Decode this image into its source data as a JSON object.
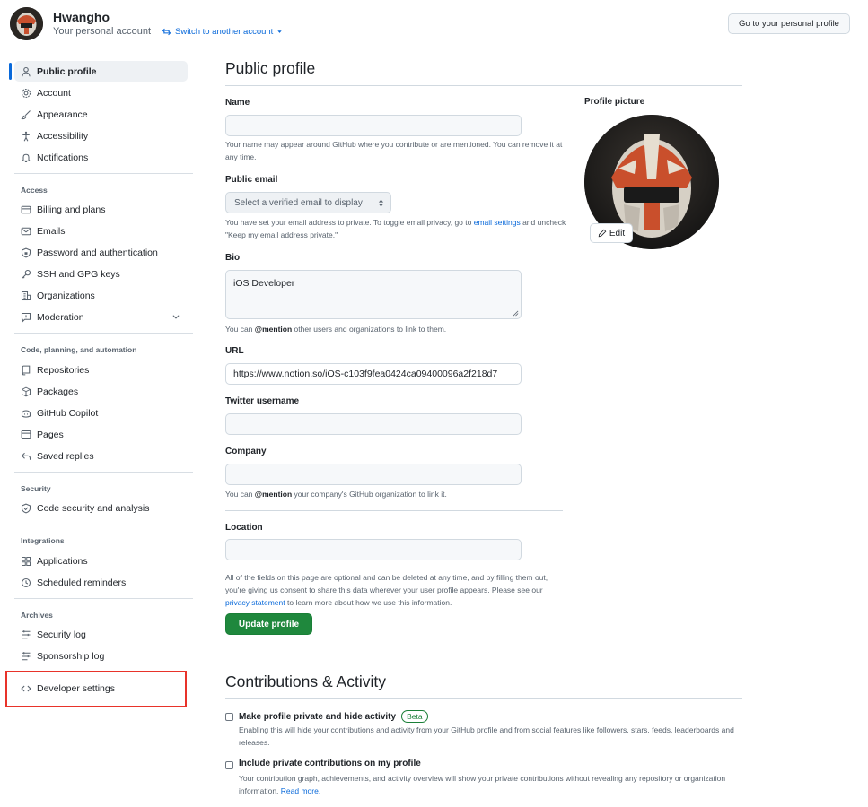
{
  "header": {
    "username": "Hwangho",
    "subtitle": "Your personal account",
    "switch_label": "Switch to another account",
    "go_profile_label": "Go to your personal profile"
  },
  "sidebar": {
    "top_items": [
      {
        "label": "Public profile",
        "icon": "person-icon",
        "active": true
      },
      {
        "label": "Account",
        "icon": "gear-icon"
      },
      {
        "label": "Appearance",
        "icon": "paintbrush-icon"
      },
      {
        "label": "Accessibility",
        "icon": "accessibility-icon"
      },
      {
        "label": "Notifications",
        "icon": "bell-icon"
      }
    ],
    "access_heading": "Access",
    "access_items": [
      {
        "label": "Billing and plans",
        "icon": "credit-card-icon"
      },
      {
        "label": "Emails",
        "icon": "mail-icon"
      },
      {
        "label": "Password and authentication",
        "icon": "shield-lock-icon"
      },
      {
        "label": "SSH and GPG keys",
        "icon": "key-icon"
      },
      {
        "label": "Organizations",
        "icon": "organization-icon"
      },
      {
        "label": "Moderation",
        "icon": "report-icon"
      }
    ],
    "code_heading": "Code, planning, and automation",
    "code_items": [
      {
        "label": "Repositories",
        "icon": "repo-icon"
      },
      {
        "label": "Packages",
        "icon": "package-icon"
      },
      {
        "label": "GitHub Copilot",
        "icon": "copilot-icon"
      },
      {
        "label": "Pages",
        "icon": "browser-icon"
      },
      {
        "label": "Saved replies",
        "icon": "reply-icon"
      }
    ],
    "security_heading": "Security",
    "security_items": [
      {
        "label": "Code security and analysis",
        "icon": "shield-icon"
      }
    ],
    "integrations_heading": "Integrations",
    "integrations_items": [
      {
        "label": "Applications",
        "icon": "apps-icon"
      },
      {
        "label": "Scheduled reminders",
        "icon": "clock-icon"
      }
    ],
    "archives_heading": "Archives",
    "archives_items": [
      {
        "label": "Security log",
        "icon": "log-icon"
      },
      {
        "label": "Sponsorship log",
        "icon": "log-icon"
      }
    ],
    "developer_settings": {
      "label": "Developer settings",
      "icon": "code-icon"
    }
  },
  "main": {
    "title": "Public profile",
    "name_label": "Name",
    "name_value": "",
    "name_hint": "Your name may appear around GitHub where you contribute or are mentioned. You can remove it at any time.",
    "email_label": "Public email",
    "email_select": "Select a verified email to display",
    "email_hint_1": "You have set your email address to private. To toggle email privacy, go to",
    "email_hint_link": "email settings",
    "email_hint_2": "and uncheck \"Keep my email address private.\"",
    "bio_label": "Bio",
    "bio_value": "iOS Developer",
    "bio_hint_1": "You can",
    "bio_hint_bold": "@mention",
    "bio_hint_2": "other users and organizations to link to them.",
    "url_label": "URL",
    "url_value": "https://www.notion.so/iOS-c103f9fea0424ca09400096a2f218d7",
    "twitter_label": "Twitter username",
    "twitter_value": "",
    "company_label": "Company",
    "company_value": "",
    "company_hint_1": "You can",
    "company_hint_bold": "@mention",
    "company_hint_2": "your company's GitHub organization to link it.",
    "location_label": "Location",
    "location_value": "",
    "consent_1": "All of the fields on this page are optional and can be deleted at any time, and by filling them out, you're giving us consent to share this data wherever your user profile appears. Please see our",
    "consent_link": "privacy statement",
    "consent_2": "to learn more about how we use this information.",
    "update_label": "Update profile",
    "picture_label": "Profile picture",
    "edit_label": "Edit",
    "contrib_title": "Contributions & Activity",
    "private_label": "Make profile private and hide activity",
    "beta_label": "Beta",
    "private_hint": "Enabling this will hide your contributions and activity from your GitHub profile and from social features like followers, stars, feeds, leaderboards and releases.",
    "include_label": "Include private contributions on my profile",
    "include_hint": "Your contribution graph, achievements, and activity overview will show your private contributions without revealing any repository or organization information.",
    "read_more": "Read more."
  }
}
